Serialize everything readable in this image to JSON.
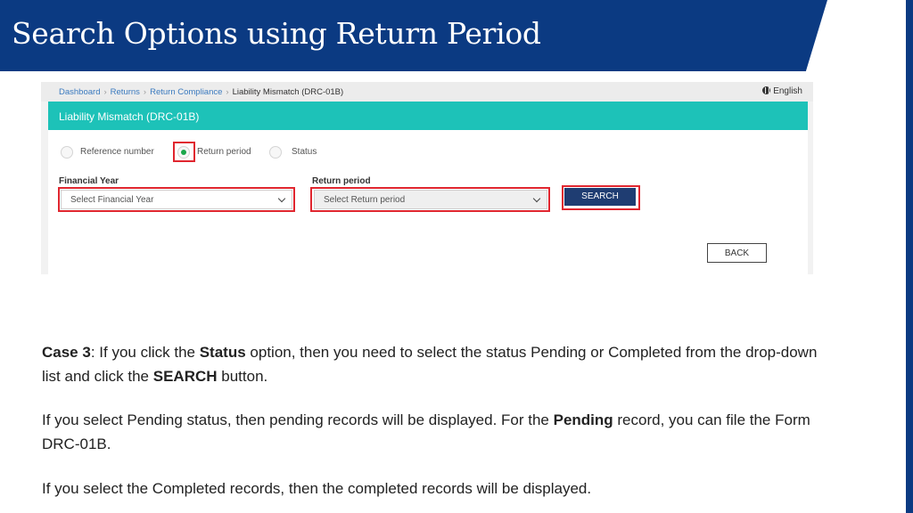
{
  "slide": {
    "title": "Search Options using Return Period"
  },
  "breadcrumb": {
    "items": [
      "Dashboard",
      "Returns",
      "Return Compliance"
    ],
    "current": "Liability Mismatch (DRC-01B)",
    "language": "English"
  },
  "panel": {
    "heading": "Liability Mismatch (DRC-01B)",
    "radios": [
      {
        "label": "Reference number",
        "selected": false
      },
      {
        "label": "Return period",
        "selected": true
      },
      {
        "label": "Status",
        "selected": false
      }
    ],
    "financial_year": {
      "label": "Financial Year",
      "placeholder": "Select Financial Year"
    },
    "return_period": {
      "label": "Return period",
      "placeholder": "Select Return period"
    },
    "search_label": "SEARCH",
    "back_label": "BACK"
  },
  "paragraphs": {
    "p1": {
      "a": "Case 3",
      "b": ": If you click the ",
      "c": "Status",
      "d": " option, then you need to select the status Pending or Completed from the drop-down list and click the ",
      "e": "SEARCH",
      "f": " button."
    },
    "p2": {
      "a": "If you select Pending status, then pending records will be displayed. For the ",
      "b": "Pending",
      "c": " record, you can file the Form DRC-01B."
    },
    "p3": "If you select the Completed records, then the completed records will be displayed."
  },
  "colors": {
    "title_bar": "#0b3a82",
    "panel_header": "#1dc2b8",
    "highlight": "#e0262f",
    "search_button": "#1f3d72"
  }
}
